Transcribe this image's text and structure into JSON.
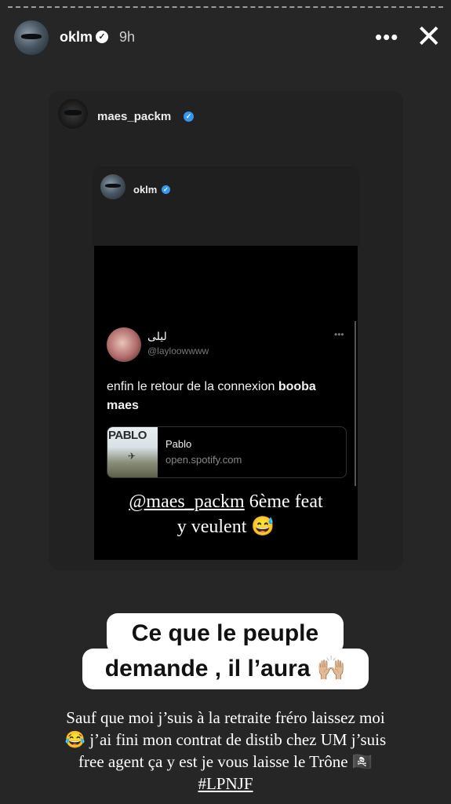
{
  "header": {
    "username": "oklm",
    "time": "9h",
    "more_icon": "more-horizontal-icon",
    "close_icon": "close-icon"
  },
  "repost": {
    "username": "maes_packm"
  },
  "inner_repost": {
    "username": "oklm"
  },
  "tweet": {
    "display_name": "ليلى",
    "handle": "@layloowwww",
    "text_prefix": "enfin le retour de la connexion ",
    "text_bold": "booba maes",
    "link_title": "Pablo",
    "link_domain": "open.spotify.com",
    "link_thumb_text": "PABLO"
  },
  "overlay_text": {
    "mention": "@maes_packm",
    "rest_line1": " 6ème feat",
    "line2": "y veulent 😅"
  },
  "sticker": {
    "line1": "Ce que le peuple",
    "line2": "demande , il l’aura 🙌🏼"
  },
  "caption": {
    "line1": "Sauf que moi j’suis à la retraite fréro laissez moi",
    "line2": "😂 j’ai fini mon contrat de distib chez UM j’suis",
    "line3": "free agent ça y est je vous laisse le Trône 🏴‍☠️",
    "hashtag": "#LPNJF"
  },
  "colors": {
    "background": "#262626",
    "verified_blue": "#3797f0",
    "text_white": "#ffffff"
  }
}
